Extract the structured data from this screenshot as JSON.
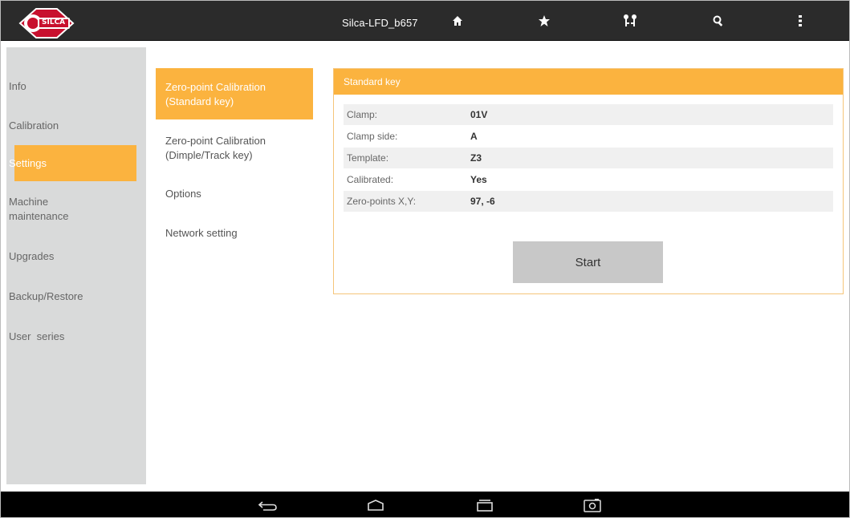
{
  "topbar": {
    "title": "Silca-LFD_b657",
    "icons": [
      "home-icon",
      "star-icon",
      "keys-icon",
      "search-icon",
      "overflow-menu-icon"
    ]
  },
  "logo": {
    "text": "SILCA"
  },
  "sidebar": {
    "items": [
      {
        "label": "Info",
        "active": false
      },
      {
        "label": "Calibration",
        "active": false
      },
      {
        "label": "Settings",
        "active": true
      },
      {
        "label": "Machine\nmaintenance",
        "active": false
      },
      {
        "label": "Upgrades",
        "active": false
      },
      {
        "label": "Backup/Restore",
        "active": false
      },
      {
        "label": "User  series",
        "active": false
      }
    ]
  },
  "submenu": {
    "items": [
      {
        "label": "Zero-point Calibration\n(Standard key)",
        "active": true
      },
      {
        "label": "Zero-point Calibration\n(Dimple/Track key)",
        "active": false
      },
      {
        "label": "Options",
        "active": false
      },
      {
        "label": "Network setting",
        "active": false
      }
    ]
  },
  "card": {
    "title": "Standard key",
    "rows": [
      {
        "label": "Clamp:",
        "value": "01V"
      },
      {
        "label": "Clamp side:",
        "value": "A"
      },
      {
        "label": "Template:",
        "value": "Z3"
      },
      {
        "label": "Calibrated:",
        "value": "Yes"
      },
      {
        "label": "Zero-points X,Y:",
        "value": "97, -6"
      }
    ],
    "start_label": "Start"
  },
  "navbar": {
    "icons": [
      "back-icon",
      "home-nav-icon",
      "recent-apps-icon",
      "screenshot-icon"
    ]
  },
  "colors": {
    "accent": "#fbb33f",
    "topbar": "#2b2b2b",
    "sidebar": "#d9dada"
  }
}
